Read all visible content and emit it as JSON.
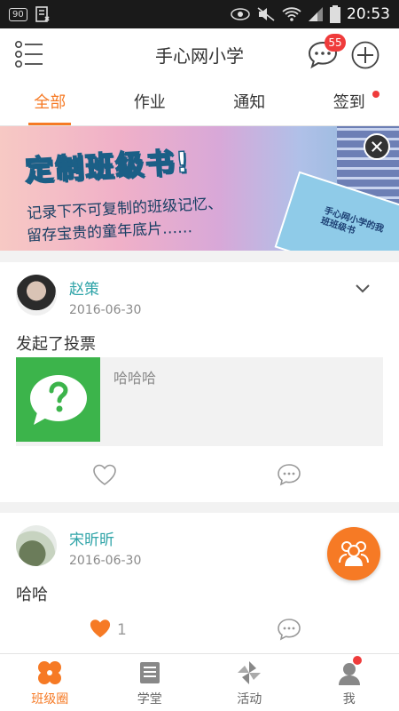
{
  "status_bar": {
    "badge": "90",
    "time": "20:53"
  },
  "header": {
    "title": "手心网小学",
    "chat_badge": "55"
  },
  "tabs": [
    {
      "label": "全部",
      "active": true
    },
    {
      "label": "作业",
      "active": false
    },
    {
      "label": "通知",
      "active": false
    },
    {
      "label": "签到",
      "active": false,
      "dot": true
    }
  ],
  "banner": {
    "title": "定制班级书!",
    "line1": "记录下不可复制的班级记忆、",
    "line2": "留存宝贵的童年底片……",
    "book_text": "手心网小学的我班班级书"
  },
  "posts": [
    {
      "author": "赵策",
      "date": "2016-06-30",
      "text": "发起了投票",
      "vote_title": "哈哈哈",
      "likes": ""
    },
    {
      "author": "宋昕昕",
      "date": "2016-06-30",
      "text": "哈哈",
      "likes": "1"
    }
  ],
  "bottom_nav": [
    {
      "label": "班级圈",
      "active": true
    },
    {
      "label": "学堂",
      "active": false
    },
    {
      "label": "活动",
      "active": false
    },
    {
      "label": "我",
      "active": false,
      "dot": true
    }
  ],
  "colors": {
    "accent": "#f67a25",
    "author": "#2fa4a8",
    "badge": "#ef3b3b",
    "vote_green": "#3cb44b"
  }
}
